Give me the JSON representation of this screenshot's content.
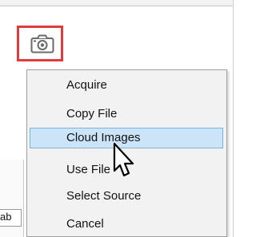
{
  "toolbar": {
    "camera_icon": "camera-icon",
    "highlight_color": "#e03a3a"
  },
  "tab_stub": {
    "label": "ab"
  },
  "context_menu": {
    "items": [
      {
        "label": "Acquire"
      },
      {
        "label": "Copy File"
      },
      {
        "label": "Cloud Images",
        "highlighted": true
      },
      {
        "label": "Use File"
      },
      {
        "label": "Select Source"
      },
      {
        "label": "Cancel"
      }
    ],
    "highlight_fill": "#cce4f7",
    "highlight_border": "#7fb2db"
  }
}
